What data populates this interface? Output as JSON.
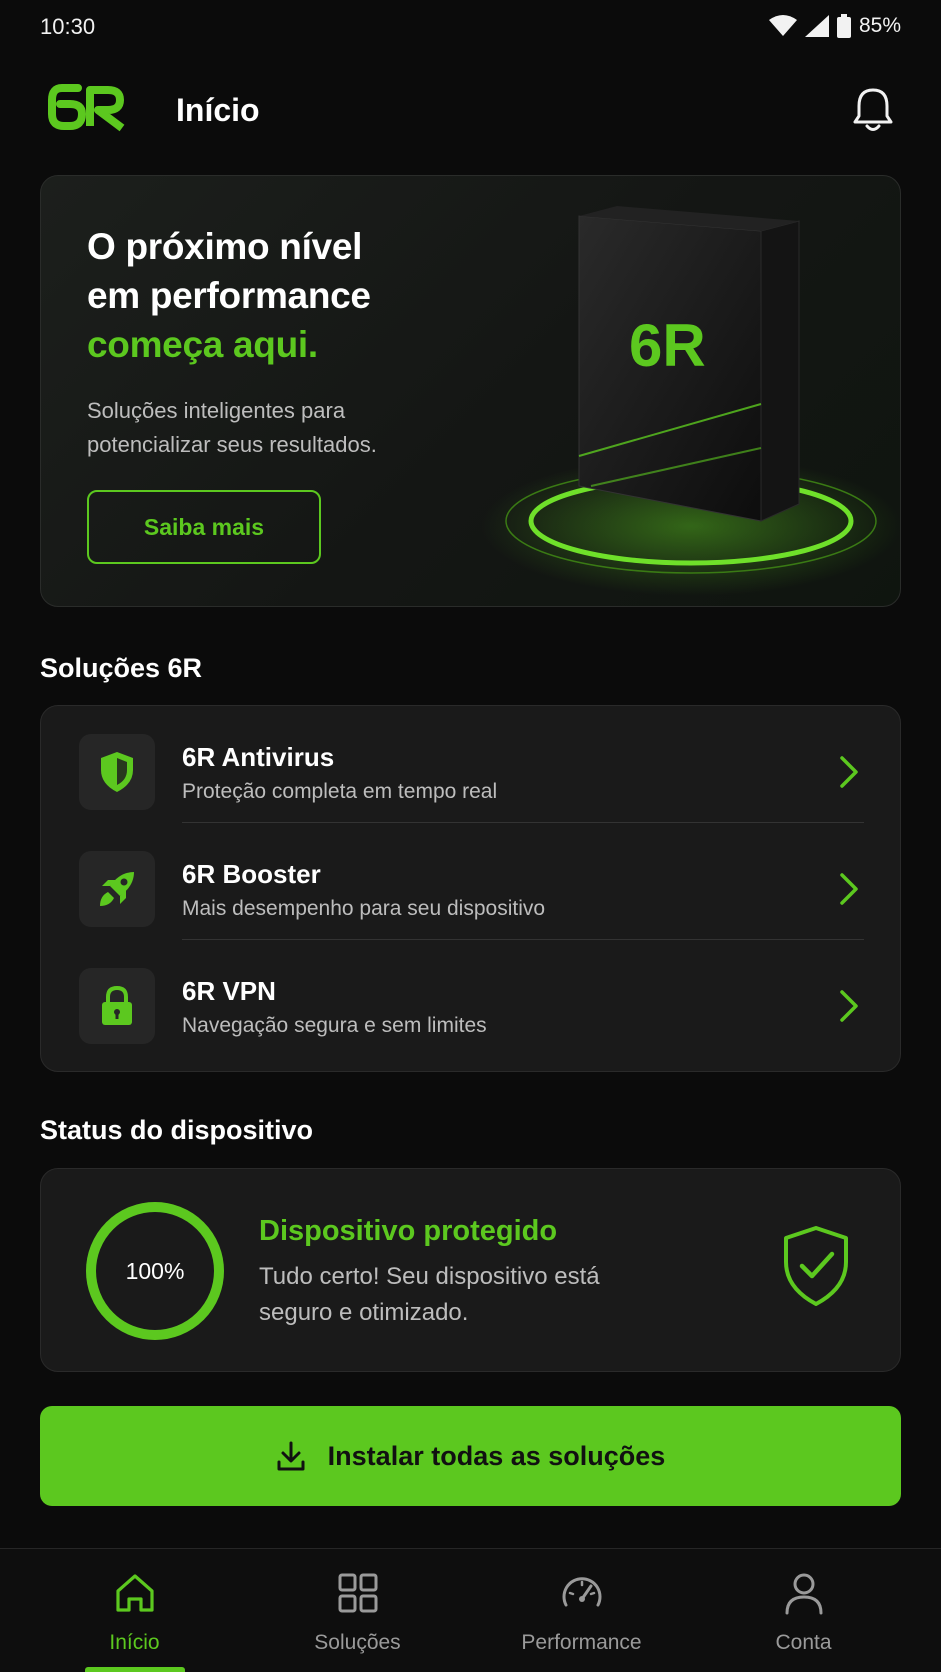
{
  "status_bar": {
    "time": "10:30",
    "battery": "85%",
    "icons": [
      "wifi-icon",
      "signal-icon",
      "battery-icon"
    ]
  },
  "header": {
    "logo_text": "6R",
    "title": "Início",
    "notification_icon": "bell-icon"
  },
  "hero": {
    "line1": "O próximo nível",
    "line2": "em performance",
    "line3": "começa aqui.",
    "subtitle": "Soluções inteligentes para potencializar seus resultados.",
    "button_label": "Saiba mais",
    "product_logo": "6R"
  },
  "solutions": {
    "title": "Soluções 6R",
    "items": [
      {
        "name": "6R Antivirus",
        "description": "Proteção completa em tempo real",
        "icon": "shield-icon"
      },
      {
        "name": "6R Booster",
        "description": "Mais desempenho para seu dispositivo",
        "icon": "rocket-icon"
      },
      {
        "name": "6R VPN",
        "description": "Navegação segura e sem limites",
        "icon": "lock-icon"
      }
    ]
  },
  "device_status": {
    "title": "Status do dispositivo",
    "percent_label": "100%",
    "percent_value": 100,
    "headline": "Dispositivo protegido",
    "description": "Tudo certo! Seu dispositivo está seguro e otimizado.",
    "icon": "shield-check-icon"
  },
  "install_button": {
    "label": "Instalar todas as soluções",
    "icon": "download-icon"
  },
  "bottom_nav": {
    "items": [
      {
        "label": "Início",
        "icon": "home-icon",
        "active": true
      },
      {
        "label": "Soluções",
        "icon": "grid-icon",
        "active": false
      },
      {
        "label": "Performance",
        "icon": "gauge-icon",
        "active": false
      },
      {
        "label": "Conta",
        "icon": "user-icon",
        "active": false
      }
    ]
  },
  "colors": {
    "accent": "#5cc81f",
    "background": "#0b0b0b",
    "card": "#1a1a1a"
  }
}
